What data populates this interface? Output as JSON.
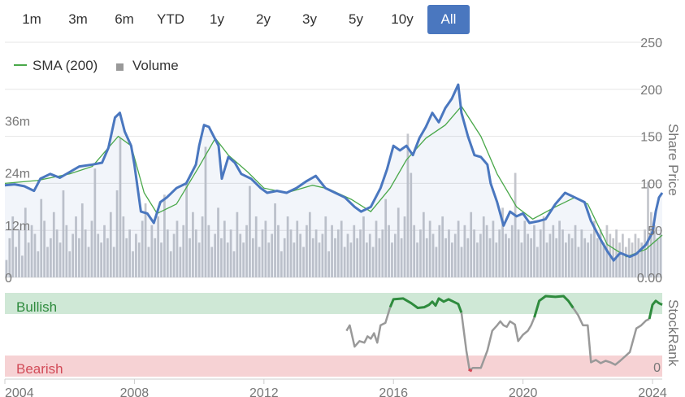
{
  "range_buttons": [
    {
      "label": "1m",
      "active": false
    },
    {
      "label": "3m",
      "active": false
    },
    {
      "label": "6m",
      "active": false
    },
    {
      "label": "YTD",
      "active": false
    },
    {
      "label": "1y",
      "active": false
    },
    {
      "label": "2y",
      "active": false
    },
    {
      "label": "3y",
      "active": false
    },
    {
      "label": "5y",
      "active": false
    },
    {
      "label": "10y",
      "active": false
    },
    {
      "label": "All",
      "active": true
    }
  ],
  "colors": {
    "price": "#4a77bf",
    "sma": "#4aa84a",
    "volume": "#c4c6cc",
    "bullish_band": "#cfe8d6",
    "bearish_band": "#f6d2d4",
    "bullish_text": "#2e8b3d",
    "bearish_text": "#d24b58",
    "rank_neutral": "#999999",
    "rank_bull": "#2e8b3d",
    "rank_bear": "#d24b58",
    "active_button": "#4a77bf"
  },
  "chart_data": {
    "type": "line",
    "legend": {
      "position": "top-left",
      "items": [
        "SMA (200)",
        "Volume"
      ]
    },
    "x_ticks": [
      "2004",
      "2008",
      "2012",
      "2016",
      "2020",
      "2024"
    ],
    "xlim": [
      2004.0,
      2024.3
    ],
    "price_axis": {
      "label": "Share Price",
      "ticks": [
        "250",
        "200",
        "150",
        "100",
        "50",
        "0.00"
      ],
      "ylim": [
        0,
        250
      ]
    },
    "volume_axis": {
      "ticks": [
        "36m",
        "24m",
        "12m",
        "0"
      ],
      "ylim": [
        0,
        54
      ]
    },
    "series": [
      {
        "name": "Price",
        "axis": "price",
        "points": [
          [
            2004.0,
            98
          ],
          [
            2004.3,
            99
          ],
          [
            2004.6,
            97
          ],
          [
            2004.9,
            92
          ],
          [
            2005.1,
            105
          ],
          [
            2005.4,
            110
          ],
          [
            2005.7,
            106
          ],
          [
            2006.0,
            112
          ],
          [
            2006.3,
            118
          ],
          [
            2006.7,
            120
          ],
          [
            2007.0,
            122
          ],
          [
            2007.2,
            138
          ],
          [
            2007.4,
            170
          ],
          [
            2007.55,
            175
          ],
          [
            2007.7,
            155
          ],
          [
            2007.9,
            140
          ],
          [
            2008.0,
            120
          ],
          [
            2008.2,
            70
          ],
          [
            2008.4,
            68
          ],
          [
            2008.6,
            58
          ],
          [
            2008.8,
            80
          ],
          [
            2009.0,
            85
          ],
          [
            2009.3,
            95
          ],
          [
            2009.6,
            100
          ],
          [
            2009.9,
            120
          ],
          [
            2010.0,
            140
          ],
          [
            2010.15,
            162
          ],
          [
            2010.3,
            160
          ],
          [
            2010.45,
            150
          ],
          [
            2010.6,
            140
          ],
          [
            2010.7,
            105
          ],
          [
            2010.9,
            128
          ],
          [
            2011.1,
            122
          ],
          [
            2011.3,
            110
          ],
          [
            2011.6,
            105
          ],
          [
            2011.9,
            95
          ],
          [
            2012.1,
            90
          ],
          [
            2012.4,
            92
          ],
          [
            2012.7,
            90
          ],
          [
            2013.0,
            95
          ],
          [
            2013.3,
            102
          ],
          [
            2013.6,
            108
          ],
          [
            2013.9,
            95
          ],
          [
            2014.2,
            90
          ],
          [
            2014.5,
            85
          ],
          [
            2014.8,
            75
          ],
          [
            2015.0,
            70
          ],
          [
            2015.3,
            75
          ],
          [
            2015.6,
            95
          ],
          [
            2015.8,
            115
          ],
          [
            2016.0,
            140
          ],
          [
            2016.2,
            135
          ],
          [
            2016.4,
            140
          ],
          [
            2016.6,
            130
          ],
          [
            2016.8,
            148
          ],
          [
            2017.0,
            160
          ],
          [
            2017.2,
            175
          ],
          [
            2017.4,
            165
          ],
          [
            2017.6,
            180
          ],
          [
            2017.8,
            190
          ],
          [
            2018.0,
            205
          ],
          [
            2018.1,
            175
          ],
          [
            2018.3,
            150
          ],
          [
            2018.5,
            130
          ],
          [
            2018.7,
            128
          ],
          [
            2018.9,
            120
          ],
          [
            2019.0,
            100
          ],
          [
            2019.2,
            80
          ],
          [
            2019.4,
            55
          ],
          [
            2019.6,
            70
          ],
          [
            2019.8,
            65
          ],
          [
            2020.0,
            68
          ],
          [
            2020.2,
            58
          ],
          [
            2020.5,
            60
          ],
          [
            2020.7,
            62
          ],
          [
            2021.0,
            78
          ],
          [
            2021.3,
            90
          ],
          [
            2021.6,
            85
          ],
          [
            2021.9,
            80
          ],
          [
            2022.1,
            60
          ],
          [
            2022.4,
            40
          ],
          [
            2022.6,
            28
          ],
          [
            2022.8,
            18
          ],
          [
            2023.0,
            26
          ],
          [
            2023.3,
            22
          ],
          [
            2023.5,
            25
          ],
          [
            2023.8,
            35
          ],
          [
            2024.0,
            48
          ],
          [
            2024.1,
            70
          ],
          [
            2024.2,
            85
          ],
          [
            2024.3,
            90
          ]
        ]
      },
      {
        "name": "SMA (200)",
        "axis": "price",
        "points": [
          [
            2004.0,
            100
          ],
          [
            2005.0,
            103
          ],
          [
            2006.0,
            110
          ],
          [
            2006.7,
            118
          ],
          [
            2007.5,
            150
          ],
          [
            2007.9,
            140
          ],
          [
            2008.3,
            90
          ],
          [
            2008.7,
            68
          ],
          [
            2009.3,
            78
          ],
          [
            2010.0,
            118
          ],
          [
            2010.5,
            148
          ],
          [
            2010.9,
            130
          ],
          [
            2011.5,
            112
          ],
          [
            2012.0,
            95
          ],
          [
            2012.7,
            90
          ],
          [
            2013.5,
            98
          ],
          [
            2014.0,
            94
          ],
          [
            2014.7,
            83
          ],
          [
            2015.3,
            70
          ],
          [
            2015.9,
            95
          ],
          [
            2016.4,
            125
          ],
          [
            2017.0,
            148
          ],
          [
            2017.6,
            162
          ],
          [
            2018.1,
            182
          ],
          [
            2018.7,
            150
          ],
          [
            2019.2,
            110
          ],
          [
            2019.8,
            75
          ],
          [
            2020.3,
            62
          ],
          [
            2021.0,
            75
          ],
          [
            2021.6,
            85
          ],
          [
            2022.0,
            78
          ],
          [
            2022.6,
            35
          ],
          [
            2023.2,
            22
          ],
          [
            2023.8,
            30
          ],
          [
            2024.3,
            45
          ]
        ]
      }
    ],
    "volume_bars": [
      4,
      9,
      14,
      7,
      11,
      5,
      16,
      8,
      12,
      10,
      6,
      18,
      13,
      7,
      9,
      15,
      11,
      8,
      20,
      12,
      6,
      10,
      14,
      9,
      17,
      11,
      7,
      13,
      25,
      10,
      8,
      12,
      9,
      15,
      7,
      20,
      32,
      14,
      9,
      11,
      6,
      10,
      8,
      13,
      17,
      7,
      12,
      9,
      14,
      8,
      19,
      11,
      6,
      10,
      13,
      7,
      12,
      22,
      9,
      15,
      11,
      8,
      14,
      30,
      12,
      7,
      10,
      16,
      9,
      13,
      8,
      11,
      6,
      15,
      10,
      8,
      12,
      21,
      9,
      14,
      7,
      11,
      13,
      8,
      10,
      17,
      12,
      6,
      9,
      14,
      11,
      8,
      13,
      10,
      7,
      12,
      15,
      9,
      11,
      8,
      10,
      14,
      6,
      12,
      9,
      11,
      13,
      7,
      10,
      8,
      12,
      9,
      11,
      14,
      8,
      10,
      7,
      13,
      9,
      11,
      18,
      12,
      8,
      10,
      16,
      9,
      14,
      33,
      24,
      12,
      8,
      11,
      15,
      9,
      13,
      10,
      7,
      12,
      14,
      9,
      11,
      8,
      10,
      13,
      7,
      12,
      9,
      15,
      11,
      8,
      10,
      14,
      12,
      9,
      13,
      8,
      11,
      16,
      10,
      9,
      12,
      24,
      11,
      8,
      13,
      10,
      9,
      12,
      7,
      11,
      14,
      8,
      10,
      12,
      9,
      13,
      11,
      8,
      10,
      9,
      12,
      7,
      11,
      9,
      8,
      10,
      13,
      9,
      11,
      8,
      12,
      10,
      9,
      11,
      8,
      10,
      7,
      9,
      8,
      10,
      9,
      8,
      11,
      22,
      15,
      12,
      9,
      10
    ],
    "stockrank": {
      "label": "StockRank",
      "bands": [
        "Bullish",
        "Bearish"
      ],
      "ticks": [
        "0"
      ],
      "ylim": [
        0,
        100
      ],
      "segments": [
        {
          "state": "neutral",
          "points": [
            [
              2014.55,
              55
            ],
            [
              2014.65,
              62
            ],
            [
              2014.8,
              35
            ],
            [
              2014.95,
              42
            ],
            [
              2015.1,
              40
            ],
            [
              2015.2,
              48
            ],
            [
              2015.3,
              45
            ],
            [
              2015.4,
              52
            ],
            [
              2015.5,
              40
            ],
            [
              2015.6,
              62
            ],
            [
              2015.75,
              65
            ],
            [
              2015.9,
              85
            ]
          ]
        },
        {
          "state": "bullish",
          "points": [
            [
              2015.9,
              85
            ],
            [
              2016.0,
              95
            ],
            [
              2016.3,
              96
            ],
            [
              2016.55,
              90
            ],
            [
              2016.75,
              84
            ],
            [
              2016.95,
              85
            ],
            [
              2017.1,
              88
            ],
            [
              2017.2,
              92
            ],
            [
              2017.3,
              87
            ],
            [
              2017.4,
              96
            ],
            [
              2017.55,
              92
            ],
            [
              2017.7,
              95
            ],
            [
              2017.85,
              92
            ],
            [
              2018.0,
              89
            ],
            [
              2018.1,
              78
            ]
          ]
        },
        {
          "state": "neutral",
          "points": [
            [
              2018.1,
              78
            ],
            [
              2018.25,
              30
            ],
            [
              2018.35,
              5
            ],
            [
              2018.45,
              8
            ],
            [
              2018.7,
              8
            ],
            [
              2018.9,
              30
            ],
            [
              2019.05,
              55
            ],
            [
              2019.2,
              62
            ],
            [
              2019.3,
              67
            ],
            [
              2019.4,
              62
            ],
            [
              2019.5,
              60
            ],
            [
              2019.6,
              67
            ],
            [
              2019.75,
              63
            ],
            [
              2019.85,
              42
            ],
            [
              2020.0,
              50
            ],
            [
              2020.15,
              55
            ],
            [
              2020.25,
              62
            ],
            [
              2020.35,
              72
            ]
          ]
        },
        {
          "state": "bullish",
          "points": [
            [
              2020.35,
              72
            ],
            [
              2020.5,
              93
            ],
            [
              2020.7,
              99
            ],
            [
              2021.0,
              98
            ],
            [
              2021.25,
              99
            ],
            [
              2021.4,
              93
            ],
            [
              2021.55,
              84
            ]
          ]
        },
        {
          "state": "neutral",
          "points": [
            [
              2021.55,
              84
            ],
            [
              2021.7,
              75
            ],
            [
              2021.85,
              62
            ],
            [
              2022.0,
              62
            ],
            [
              2022.1,
              15
            ],
            [
              2022.25,
              18
            ],
            [
              2022.4,
              14
            ],
            [
              2022.55,
              17
            ],
            [
              2022.7,
              15
            ],
            [
              2022.85,
              12
            ],
            [
              2023.0,
              17
            ],
            [
              2023.3,
              28
            ],
            [
              2023.5,
              58
            ],
            [
              2023.65,
              62
            ],
            [
              2023.8,
              68
            ],
            [
              2023.9,
              70
            ]
          ]
        },
        {
          "state": "bullish",
          "points": [
            [
              2023.9,
              70
            ],
            [
              2024.0,
              88
            ],
            [
              2024.1,
              93
            ],
            [
              2024.2,
              90
            ],
            [
              2024.3,
              88
            ]
          ]
        }
      ]
    }
  }
}
